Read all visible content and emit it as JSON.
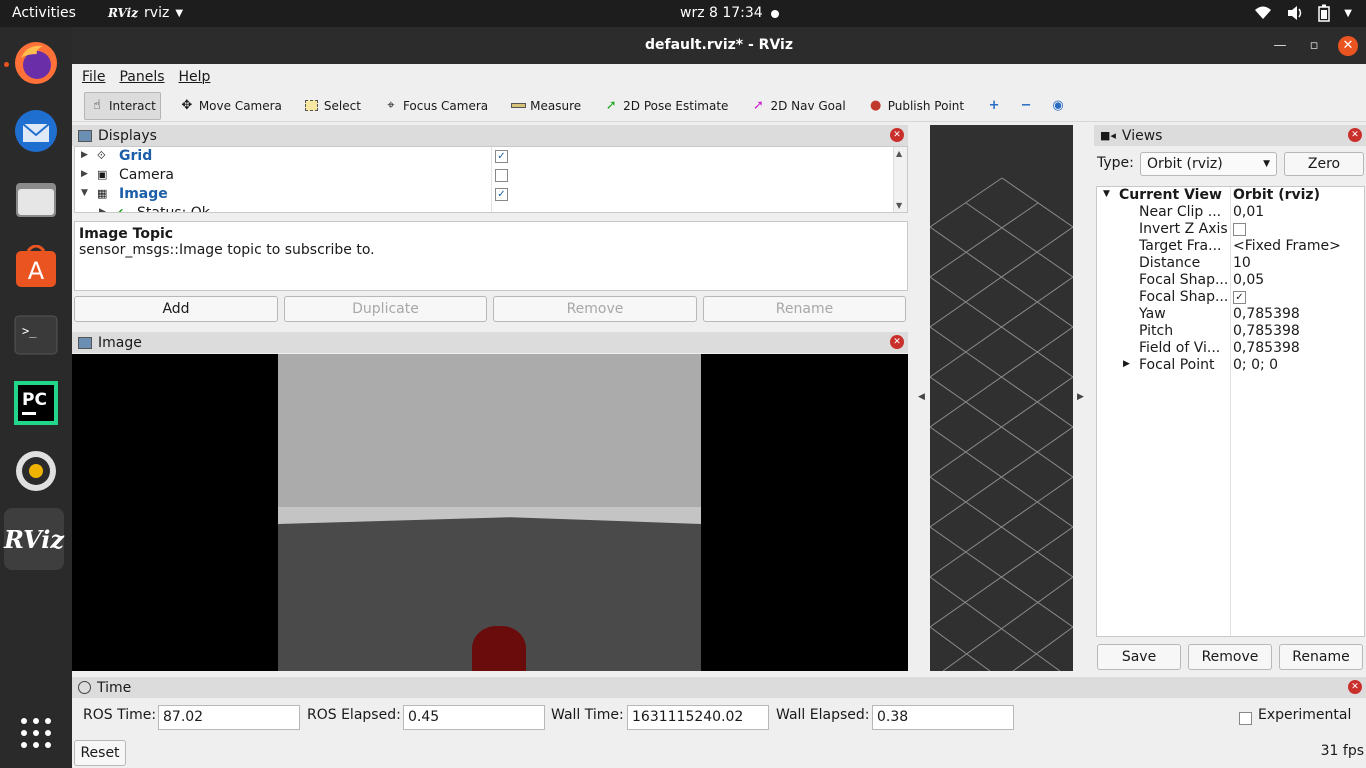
{
  "topbar": {
    "activities": "Activities",
    "app_name": "rviz",
    "clock": "wrz 8  17:34"
  },
  "dock": {
    "items": [
      "firefox-icon",
      "thunderbird-icon",
      "files-icon",
      "software-icon",
      "terminal-icon",
      "pycharm-icon",
      "rhythmbox-icon",
      "rviz-icon",
      "show-apps-icon"
    ],
    "pycharm_label": "PC",
    "rviz_label": "RViz"
  },
  "window": {
    "title": "default.rviz* - RViz"
  },
  "menu": [
    "File",
    "Panels",
    "Help"
  ],
  "toolbar": {
    "tools": [
      "Interact",
      "Move Camera",
      "Select",
      "Focus Camera",
      "Measure",
      "2D Pose Estimate",
      "2D Nav Goal",
      "Publish Point"
    ]
  },
  "displays": {
    "title": "Displays",
    "items": [
      {
        "label": "Grid",
        "checked": true
      },
      {
        "label": "Camera",
        "checked": false
      },
      {
        "label": "Image",
        "checked": true
      },
      {
        "label": "Status: Ok"
      }
    ],
    "description_title": "Image Topic",
    "description_text": "sensor_msgs::Image topic to subscribe to.",
    "buttons": {
      "add": "Add",
      "duplicate": "Duplicate",
      "remove": "Remove",
      "rename": "Rename"
    }
  },
  "image_panel": {
    "title": "Image"
  },
  "views": {
    "title": "Views",
    "type_label": "Type:",
    "type_value": "Orbit (rviz)",
    "zero_button": "Zero",
    "current_view": {
      "name": "Current View",
      "value": "Orbit (rviz)"
    },
    "properties": [
      {
        "name": "Near Clip ...",
        "value": "0,01"
      },
      {
        "name": "Invert Z Axis",
        "value": ""
      },
      {
        "name": "Target Fra...",
        "value": "<Fixed Frame>"
      },
      {
        "name": "Distance",
        "value": "10"
      },
      {
        "name": "Focal Shap...",
        "value": "0,05"
      },
      {
        "name": "Focal Shap...",
        "value": ""
      },
      {
        "name": "Yaw",
        "value": "0,785398"
      },
      {
        "name": "Pitch",
        "value": "0,785398"
      },
      {
        "name": "Field of Vi...",
        "value": "0,785398"
      },
      {
        "name": "Focal Point",
        "value": "0; 0; 0"
      }
    ],
    "buttons": {
      "save": "Save",
      "remove": "Remove",
      "rename": "Rename"
    }
  },
  "time": {
    "title": "Time",
    "ros_time_label": "ROS Time:",
    "ros_time": "87.02",
    "ros_elapsed_label": "ROS Elapsed:",
    "ros_elapsed": "0.45",
    "wall_time_label": "Wall Time:",
    "wall_time": "1631115240.02",
    "wall_elapsed_label": "Wall Elapsed:",
    "wall_elapsed": "0.38",
    "experimental_label": "Experimental",
    "reset_button": "Reset",
    "fps": "31 fps"
  }
}
